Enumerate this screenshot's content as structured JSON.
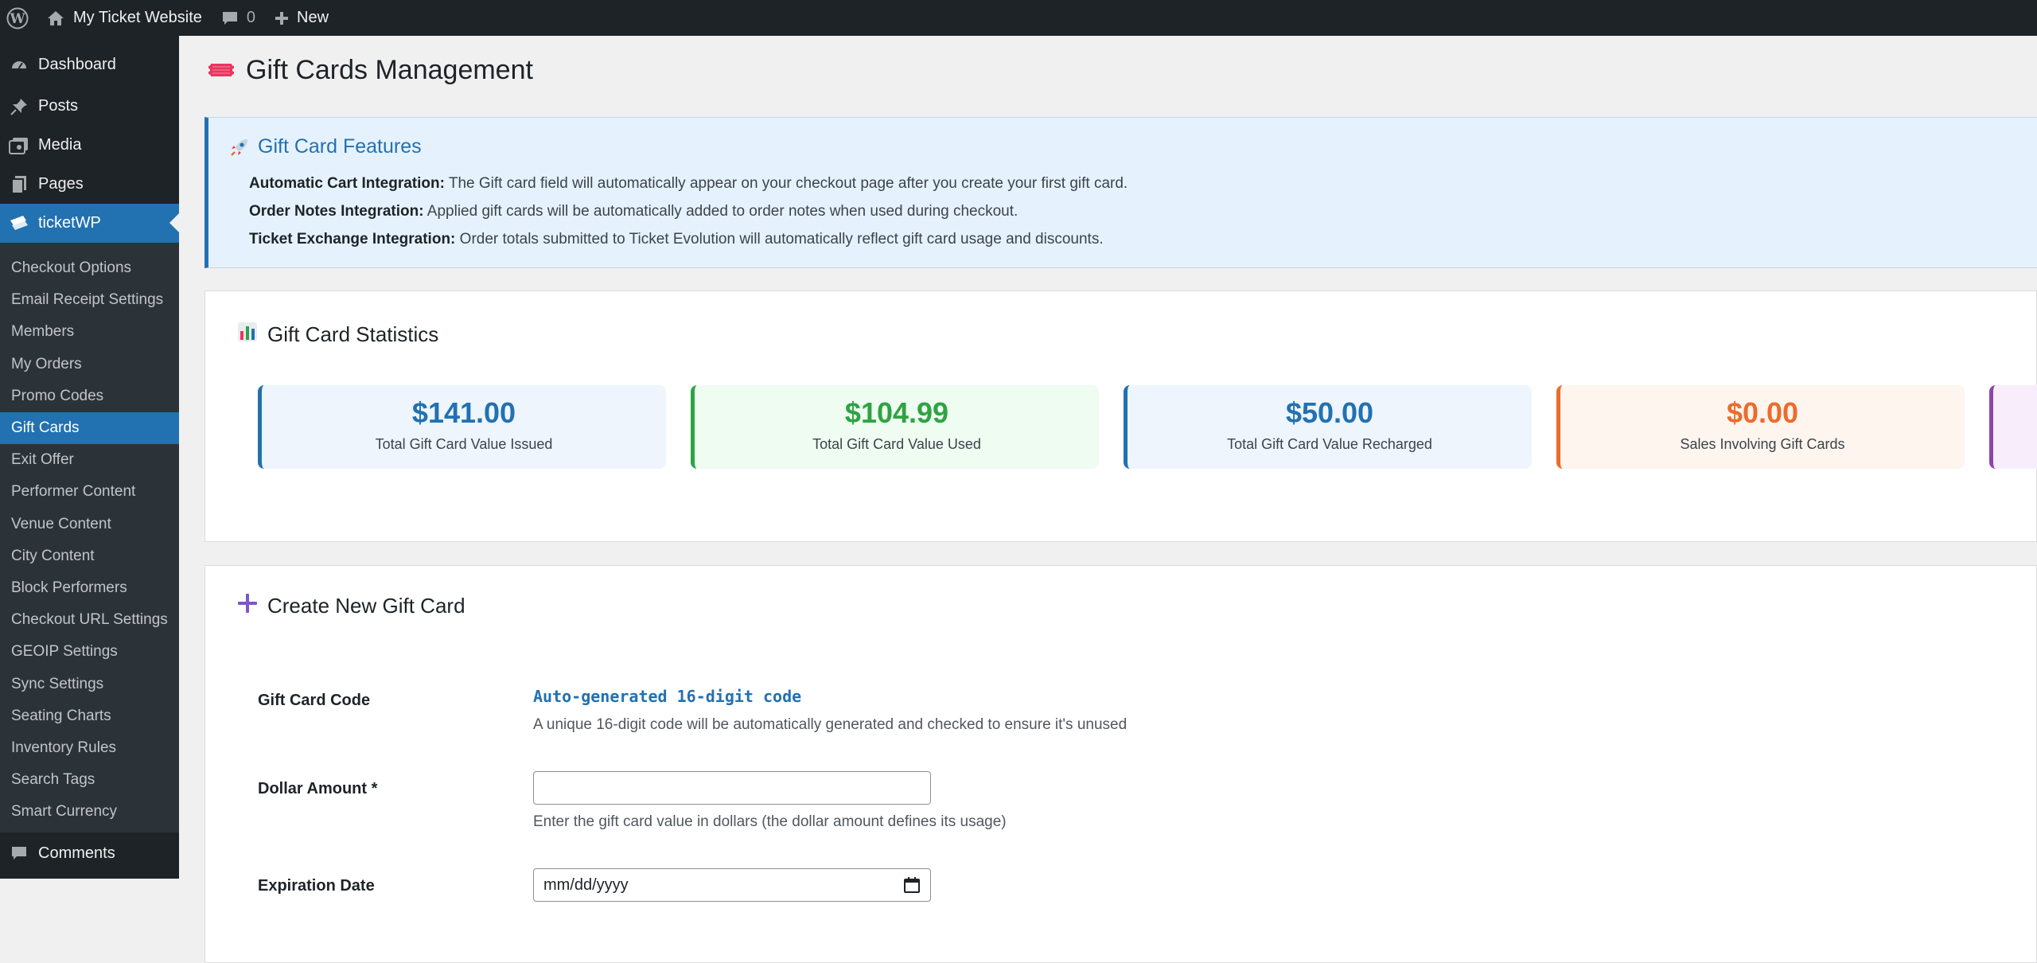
{
  "admin_bar": {
    "site_name": "My Ticket Website",
    "comments_count": "0",
    "new_label": "New"
  },
  "sidebar": {
    "dashboard": "Dashboard",
    "posts": "Posts",
    "media": "Media",
    "pages": "Pages",
    "ticketwp": "ticketWP",
    "submenu": [
      "Checkout Options",
      "Email Receipt Settings",
      "Members",
      "My Orders",
      "Promo Codes",
      "Gift Cards",
      "Exit Offer",
      "Performer Content",
      "Venue Content",
      "City Content",
      "Block Performers",
      "Checkout URL Settings",
      "GEOIP Settings",
      "Sync Settings",
      "Seating Charts",
      "Inventory Rules",
      "Search Tags",
      "Smart Currency"
    ],
    "comments": "Comments"
  },
  "page": {
    "title": "Gift Cards Management"
  },
  "features": {
    "title": "Gift Card Features",
    "lines": [
      {
        "label": "Automatic Cart Integration:",
        "text": " The Gift card field will automatically appear on your checkout page after you create your first gift card."
      },
      {
        "label": "Order Notes Integration:",
        "text": " Applied gift cards will be automatically added to order notes when used during checkout."
      },
      {
        "label": "Ticket Exchange Integration:",
        "text": " Order totals submitted to Ticket Evolution will automatically reflect gift card usage and discounts."
      }
    ]
  },
  "stats": {
    "title": "Gift Card Statistics",
    "items": [
      {
        "value": "$141.00",
        "label": "Total Gift Card Value Issued"
      },
      {
        "value": "$104.99",
        "label": "Total Gift Card Value Used"
      },
      {
        "value": "$50.00",
        "label": "Total Gift Card Value Recharged"
      },
      {
        "value": "$0.00",
        "label": "Sales Involving Gift Cards"
      }
    ]
  },
  "create": {
    "title": "Create New Gift Card",
    "code_label": "Gift Card Code",
    "code_value": "Auto-generated 16-digit code",
    "code_help": "A unique 16-digit code will be automatically generated and checked to ensure it's unused",
    "amount_label": "Dollar Amount *",
    "amount_value": "",
    "amount_help": "Enter the gift card value in dollars (the dollar amount defines its usage)",
    "expiration_label": "Expiration Date",
    "expiration_placeholder": "mm/dd/yyyy"
  },
  "colors": {
    "accent": "#2271b1",
    "green": "#2ea343",
    "orange": "#ec6b2d",
    "purple": "#8e44ad",
    "admin_dark": "#1d2327"
  }
}
